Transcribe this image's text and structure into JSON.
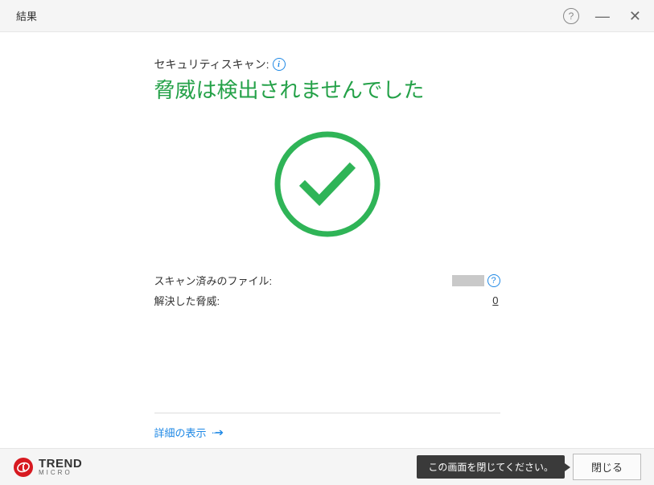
{
  "window": {
    "title": "結果"
  },
  "scan": {
    "label": "セキュリティスキャン:",
    "result_heading": "脅威は検出されませんでした"
  },
  "stats": {
    "scanned_label": "スキャン済みのファイル:",
    "resolved_label": "解決した脅威:",
    "resolved_value": "0"
  },
  "links": {
    "details": "詳細の表示"
  },
  "brand": {
    "main": "TREND",
    "sub": "MICRO"
  },
  "footer": {
    "tooltip": "この画面を閉じてください。",
    "close_button": "閉じる"
  }
}
